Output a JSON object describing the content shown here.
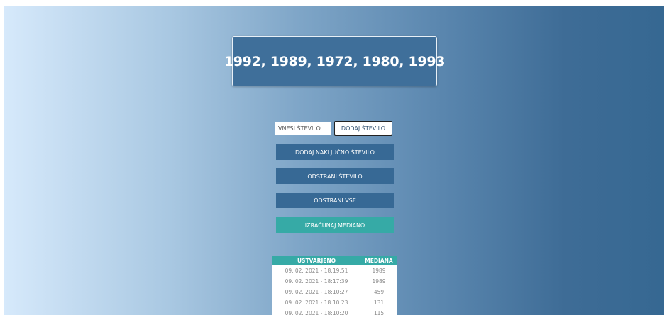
{
  "display": {
    "numbers_text": "1992, 1989, 1972, 1980, 1993"
  },
  "input": {
    "placeholder": "VNESI ŠTEVILO",
    "value": ""
  },
  "buttons": {
    "add_number": "DODAJ ŠTEVILO",
    "add_random": "DODAJ NAKLJUČNO ŠTEVILO",
    "remove_number": "ODSTRANI ŠTEVILO",
    "remove_all": "ODSTRANI VSE",
    "calculate_median": "IZRAČUNAJ MEDIANO"
  },
  "history": {
    "headers": {
      "created": "USTVARJENO",
      "median": "MEDIANA"
    },
    "rows": [
      {
        "created": "09. 02. 2021 - 18:19:51",
        "median": "1989"
      },
      {
        "created": "09. 02. 2021 - 18:17:39",
        "median": "1989"
      },
      {
        "created": "09. 02. 2021 - 18:10:27",
        "median": "459"
      },
      {
        "created": "09. 02. 2021 - 18:10:23",
        "median": "131"
      },
      {
        "created": "09. 02. 2021 - 18:10:20",
        "median": "115"
      }
    ]
  },
  "colors": {
    "primary_button": "#376995",
    "accent_teal": "#36aaa6",
    "display_box": "#3f6f9a"
  }
}
